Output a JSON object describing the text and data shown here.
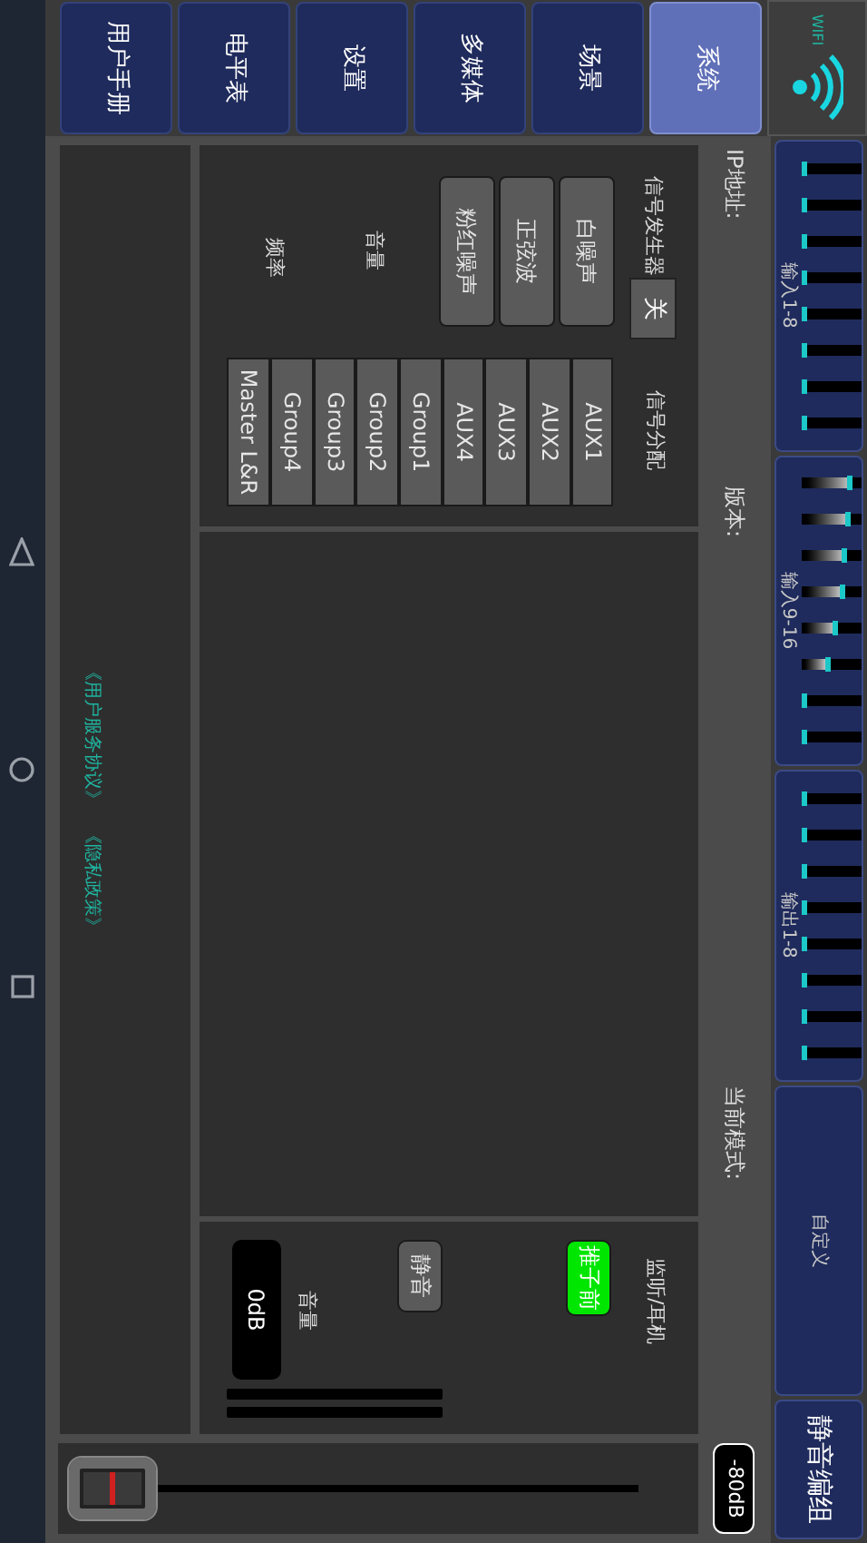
{
  "wifi": {
    "label": "WIFI"
  },
  "tabs": [
    {
      "label": "系统",
      "selected": true
    },
    {
      "label": "场景",
      "selected": false
    },
    {
      "label": "多媒体",
      "selected": false
    },
    {
      "label": "设置",
      "selected": false
    },
    {
      "label": "电平表",
      "selected": false
    },
    {
      "label": "用户手册",
      "selected": false
    }
  ],
  "channel_groups": [
    {
      "label": "输入1-8",
      "meters": [
        {
          "level": 0
        },
        {
          "level": 0
        },
        {
          "level": 0
        },
        {
          "level": 0
        },
        {
          "level": 0
        },
        {
          "level": 0
        },
        {
          "level": 0
        },
        {
          "level": 0
        }
      ]
    },
    {
      "label": "输入9-16",
      "meters": [
        {
          "level": 0.85
        },
        {
          "level": 0.81
        },
        {
          "level": 0.75
        },
        {
          "level": 0.69
        },
        {
          "level": 0.58
        },
        {
          "level": 0.43
        },
        {
          "level": 0
        },
        {
          "level": 0
        }
      ]
    },
    {
      "label": "输出1-8",
      "meters": [
        {
          "level": 0
        },
        {
          "level": 0
        },
        {
          "level": 0
        },
        {
          "level": 0
        },
        {
          "level": 0
        },
        {
          "level": 0
        },
        {
          "level": 0
        },
        {
          "level": 0
        }
      ]
    },
    {
      "label": "自定义"
    }
  ],
  "mute_group_button": "静音编组",
  "info": {
    "ip_label": "IP地址:",
    "version_label": "版本:",
    "mode_label": "当前模式:"
  },
  "signal_generator": {
    "title": "信号发生器",
    "power_button": "关",
    "types": [
      {
        "label": "白噪声",
        "selected": false
      },
      {
        "label": "正弦波",
        "selected": false
      },
      {
        "label": "粉红噪声",
        "selected": false
      }
    ],
    "volume_label": "音量",
    "frequency_label": "频率"
  },
  "signal_routing": {
    "title": "信号分配",
    "targets": [
      {
        "label": "AUX1",
        "selected": false
      },
      {
        "label": "AUX2",
        "selected": false
      },
      {
        "label": "AUX3",
        "selected": false
      },
      {
        "label": "AUX4",
        "selected": false
      },
      {
        "label": "Group1",
        "selected": false
      },
      {
        "label": "Group2",
        "selected": false
      },
      {
        "label": "Group3",
        "selected": false
      },
      {
        "label": "Group4",
        "selected": false
      },
      {
        "label": "Master L&R",
        "selected": false
      }
    ]
  },
  "monitor": {
    "title": "监听/耳机",
    "pre_fader": {
      "label": "推子前",
      "on": true
    },
    "mute": {
      "label": "静音",
      "on": false
    },
    "volume_label": "音量",
    "volume_reading": "0dB",
    "meters": [
      {
        "level": 0
      },
      {
        "level": 0
      }
    ]
  },
  "links": [
    "《用户服务协议》",
    "《隐私政策》"
  ],
  "fader": {
    "reading": "-80dB",
    "level": 0
  }
}
